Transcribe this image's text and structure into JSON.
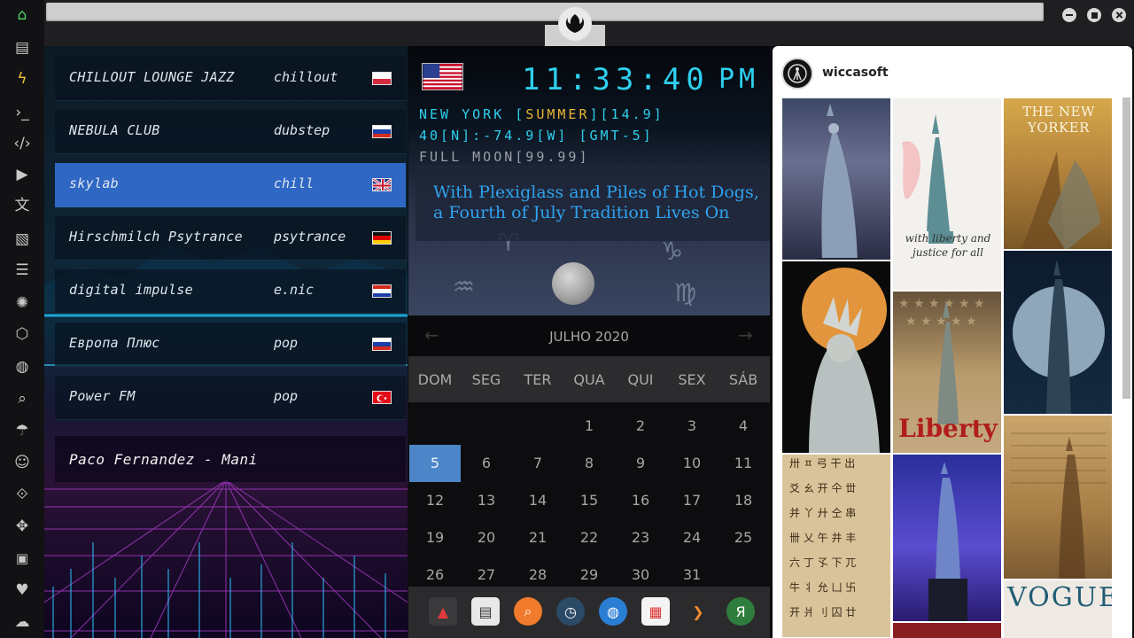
{
  "rail": {
    "icons": [
      "home-icon",
      "document-icon",
      "flash-icon",
      "terminal-icon",
      "code-icon",
      "play-icon",
      "translate-icon",
      "image-icon",
      "news-icon",
      "aperture-icon",
      "hexagon-icon",
      "globe-icon",
      "search-icon",
      "umbrella-icon",
      "contact-icon",
      "share-icon",
      "expand-icon",
      "youtube-icon",
      "heart-icon",
      "cloud-icon"
    ]
  },
  "window": {
    "emblem_icon": "rebel-alliance-icon"
  },
  "radio": {
    "stations": [
      {
        "name": "CHILLOUT LOUNGE JAZZ",
        "genre": "chillout",
        "flag": [
          "#ffffff",
          "#d52b3f"
        ]
      },
      {
        "name": "NEBULA CLUB",
        "genre": "dubstep",
        "flag": [
          "#ffffff",
          "#1c3fa8",
          "#d52b1e"
        ]
      },
      {
        "name": "skylab",
        "genre": "chill",
        "flag": "uk"
      },
      {
        "name": "Hirschmilch Psytrance",
        "genre": "psytrance",
        "flag": [
          "#111111",
          "#dd0000",
          "#ffce00"
        ]
      },
      {
        "name": "digital impulse",
        "genre": "e.nic",
        "flag": [
          "#d52b1e",
          "#ffffff",
          "#1c3fa8"
        ]
      },
      {
        "name": "Европа Плюс",
        "genre": "pop",
        "flag": [
          "#ffffff",
          "#1c3fa8",
          "#d52b1e"
        ]
      },
      {
        "name": "Power FM",
        "genre": "pop",
        "flag": "tr"
      }
    ],
    "now_playing": "Paco Fernandez - Mani"
  },
  "clock": {
    "time": "11:33:40",
    "ampm": "PM",
    "city": "NEW YORK [",
    "dst": "SUMMER",
    "temp": "][14.9]",
    "coords": "40[N]:-74.9[W] [GMT-5]",
    "moon": "FULL MOON[99.99]",
    "headline": "With Plexiglass and Piles of Hot Dogs, a Fourth of July Tradition Lives On"
  },
  "calendar": {
    "month": "JULHO 2020",
    "weekdays": [
      "DOM",
      "SEG",
      "TER",
      "QUA",
      "QUI",
      "SEX",
      "SÁB"
    ],
    "weeks": [
      [
        "",
        "",
        "",
        "1",
        "2",
        "3",
        "4"
      ],
      [
        "5",
        "6",
        "7",
        "8",
        "9",
        "10",
        "11"
      ],
      [
        "12",
        "13",
        "14",
        "15",
        "16",
        "17",
        "18"
      ],
      [
        "19",
        "20",
        "21",
        "22",
        "23",
        "24",
        "25"
      ],
      [
        "26",
        "27",
        "28",
        "29",
        "30",
        "31",
        ""
      ]
    ],
    "today": "5"
  },
  "dock": {
    "apps": [
      "app-launcher-icon",
      "news-reader-icon",
      "search-app-icon",
      "clock-app-icon",
      "browser-icon",
      "calendar-app-icon",
      "terminal-app-icon",
      "yandex-icon"
    ]
  },
  "feed": {
    "username": "wiccasoft",
    "captions": {
      "liberty_script": "with liberty and justice for all",
      "liberty_title": "Liberty",
      "new_yorker": "THE NEW YORKER",
      "vogue": "VOGUE"
    }
  }
}
